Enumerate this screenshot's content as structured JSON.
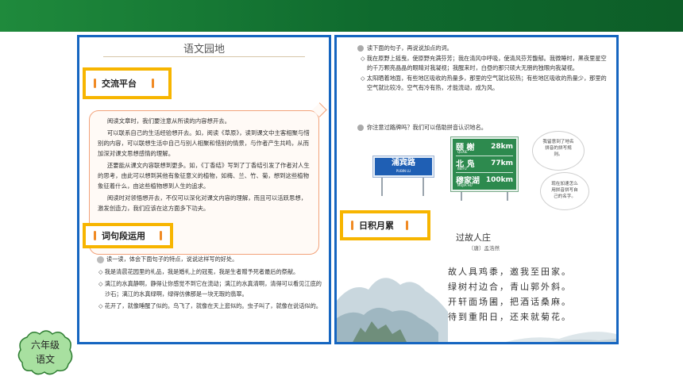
{
  "left_page": {
    "title": "语文园地",
    "tag1": "交流平台",
    "paragraphs": [
      "阅读文章时，我们要注意从所读的内容想开去。",
      "可以联系自己的生活经验想开去。如，阅读《草原》，读到课文中主客相聚与惜别的内容，可以联想生活中自己与别人相聚和惜别的情景，与作者产生共鸣，从而加深对课文思想感情的理解。",
      "还要能从课文内容联想到更多。如，《丁香结》写到了丁香结引发了作者对人生的思考，由此可以想到其他有象征意义的植物，如梅、兰、竹、菊，想到这些植物象征着什么，由这些植物想到人生的追求。",
      "阅读时对领悟想开去，不仅可以深化对课文内容的理解，而且可以活跃思想，激发创造力，我们应该在这方面多下功夫。"
    ],
    "tag2": "词句段运用",
    "intro": "读一读，体会下面句子的特点，说说这样写的好处。",
    "items": [
      "◇ 我是清晨花园里的礼品，我是婚礼上的冠冕，我是生者赠予死者最后的祭献。",
      "◇ 漓江的水真静啊，静得让你感觉不到它在流动；漓江的水真清啊，清得可以看见江底的沙石；漓江的水真绿啊，绿得仿佛那是一块无瑕的翡翠。",
      "◇ 花开了，就像睡醒了似的。鸟飞了，就像在天上逛似的。虫子叫了，就像在说话似的。"
    ]
  },
  "right_page": {
    "q1": "读下面的句子，再说说加点的词。",
    "q1_items": [
      "◇ 我在原野上摇曳，使原野充满芬芳；我在清风中呼吸，使清风芬芳馥郁。我微睡时，黑夜里星空的千万颗亮晶晶的眼睛对我凝视；我醒来时，白昼的那只硕大无朋的独眼向我凝视。",
      "◇ 太阳晒着地面，有些地区吸收的热量多，那里的空气就比较热；有些地区吸收的热量少，那里的空气就比较冷。空气有冷有热，才能流动，成为风。"
    ],
    "q2": "你注意过路牌吗？我们可以借助拼音认识地名。",
    "sign1": {
      "name": "浦宾路",
      "pinyin": "PUBIN LU"
    },
    "sign2": [
      {
        "name": "颐 榭",
        "pinyin": "QUXIE",
        "km": "28km"
      },
      {
        "name": "北 凫",
        "pinyin": "BEIFU",
        "km": "77km"
      },
      {
        "name": "穆家湖",
        "pinyin": "MUJIA HU",
        "km": "100km"
      }
    ],
    "cloud1": "我留意到了地名拼音的拼写规则。",
    "cloud2": "现在加速怎么用拼音拼写自己的名字。",
    "tag3": "日积月累",
    "poem_title": "过故人庄",
    "poem_author": "〔唐〕孟浩然",
    "poem_lines": [
      "故人具鸡黍，邀我至田家。",
      "绿树村边合，青山郭外斜。",
      "开轩面场圃，把酒话桑麻。",
      "待到重阳日，还来就菊花。"
    ]
  },
  "badge": {
    "line1": "六年级",
    "line2": "语文"
  },
  "colors": {
    "frame": "#1565c0",
    "tag_border": "#f7b500",
    "top_bar": "#1f8a3c"
  }
}
